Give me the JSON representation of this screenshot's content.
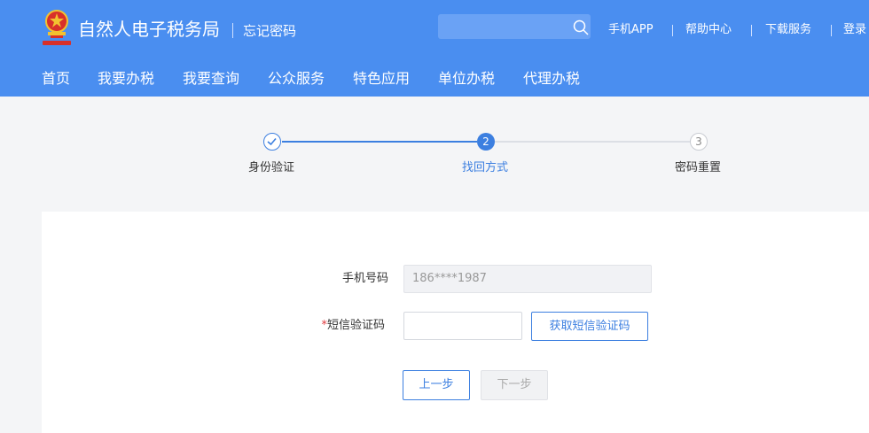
{
  "header": {
    "site_title": "自然人电子税务局",
    "page_subtitle": "忘记密码",
    "search_placeholder": "",
    "links": [
      "手机APP",
      "帮助中心",
      "下载服务",
      "登录"
    ]
  },
  "nav": {
    "items": [
      "首页",
      "我要办税",
      "我要查询",
      "公众服务",
      "特色应用",
      "单位办税",
      "代理办税"
    ]
  },
  "steps": [
    {
      "label": "身份验证",
      "state": "done"
    },
    {
      "label": "找回方式",
      "number": "2",
      "state": "active"
    },
    {
      "label": "密码重置",
      "number": "3",
      "state": "pending"
    }
  ],
  "form": {
    "phone_label": "手机号码",
    "phone_value": "186****1987",
    "sms_required_mark": "*",
    "sms_label": "短信验证码",
    "sms_value": "",
    "get_code_button": "获取短信验证码",
    "prev_button": "上一步",
    "next_button": "下一步"
  },
  "colors": {
    "header_bg": "#4a8ef0",
    "primary": "#3c7fe0",
    "required": "#e0393e"
  }
}
